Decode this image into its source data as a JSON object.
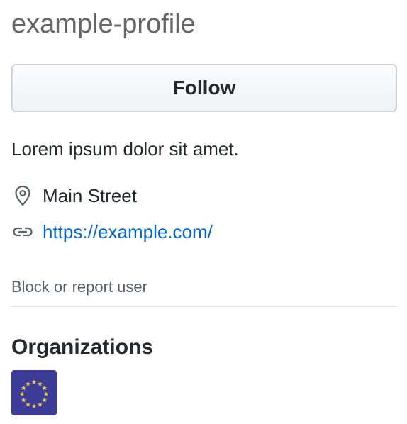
{
  "profile": {
    "username": "example-profile",
    "follow_label": "Follow",
    "bio": "Lorem ipsum dolor sit amet.",
    "location": "Main Street",
    "website": "https://example.com/",
    "block_label": "Block or report user"
  },
  "organizations": {
    "heading": "Organizations",
    "items": [
      {
        "icon": "eu-flag-icon",
        "color": "#3d3d99",
        "star_color": "#f4d23c"
      }
    ]
  },
  "colors": {
    "link": "#0366d6",
    "muted": "#586069",
    "text": "#24292e"
  },
  "icons": {
    "location": "location-pin-icon",
    "website": "link-icon"
  }
}
